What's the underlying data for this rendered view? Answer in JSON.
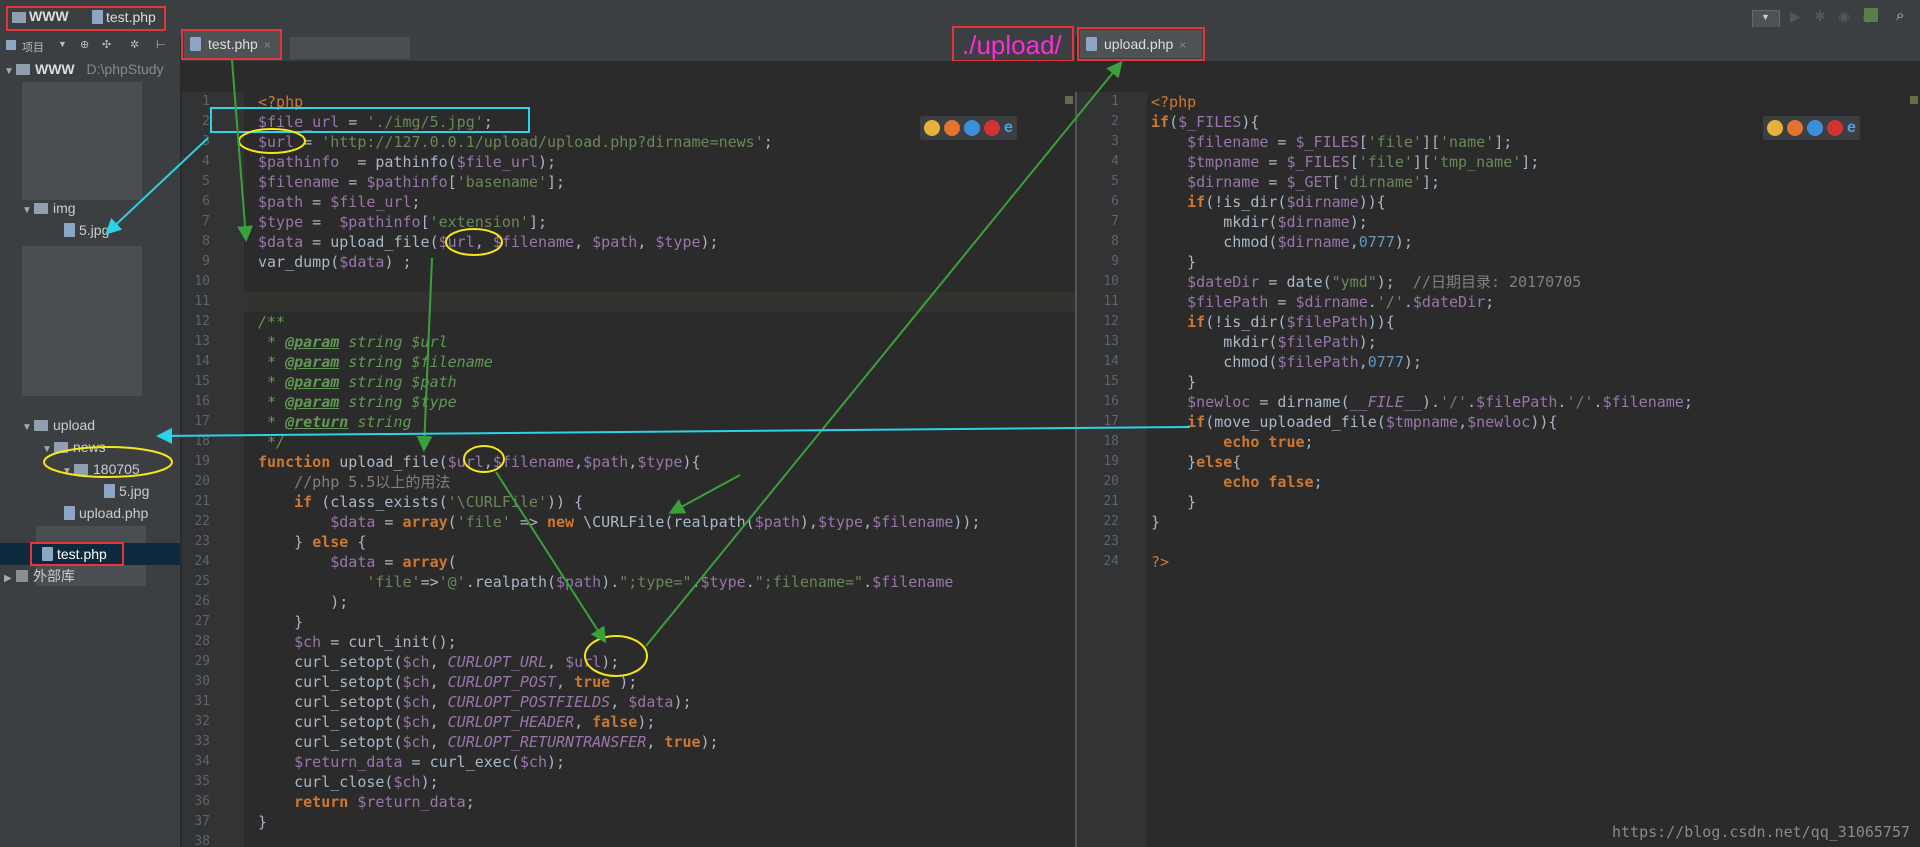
{
  "titlebar": {
    "project": "WWW",
    "file": "test.php"
  },
  "toolbar": {
    "project_label": "项目"
  },
  "sidebar": {
    "root_name": "WWW",
    "root_path": "D:\\phpStudy",
    "items": [
      {
        "label": "img"
      },
      {
        "label": "5.jpg"
      },
      {
        "label": "upload"
      },
      {
        "label": "news"
      },
      {
        "label": "180705"
      },
      {
        "label": "5.jpg"
      },
      {
        "label": "upload.php"
      },
      {
        "label": "test.php"
      },
      {
        "label": "外部库"
      }
    ]
  },
  "tabs": {
    "left": "test.php",
    "right": "upload.php"
  },
  "annotation": {
    "upload_path": "./upload/"
  },
  "left_editor": {
    "lines": [
      "<?php",
      "$file_url = './img/5.jpg';",
      "$url = 'http://127.0.0.1/upload/upload.php?dirname=news';",
      "$pathinfo  = pathinfo($file_url);",
      "$filename = $pathinfo['basename'];",
      "$path = $file_url;",
      "$type =  $pathinfo['extension'];",
      "$data = upload_file($url, $filename, $path, $type);",
      "var_dump($data) ;",
      "",
      "",
      "/**",
      " * @param string $url",
      " * @param string $filename",
      " * @param string $path",
      " * @param string $type",
      " * @return string",
      " */",
      "function upload_file($url,$filename,$path,$type){",
      "    //php 5.5以上的用法",
      "    if (class_exists('\\CURLFile')) {",
      "        $data = array('file' => new \\CURLFile(realpath($path),$type,$filename));",
      "    } else {",
      "        $data = array(",
      "            'file'=>'@'.realpath($path).\";type=\".$type.\";filename=\".$filename",
      "        );",
      "    }",
      "    $ch = curl_init();",
      "    curl_setopt($ch, CURLOPT_URL, $url);",
      "    curl_setopt($ch, CURLOPT_POST, true );",
      "    curl_setopt($ch, CURLOPT_POSTFIELDS, $data);",
      "    curl_setopt($ch, CURLOPT_HEADER, false);",
      "    curl_setopt($ch, CURLOPT_RETURNTRANSFER, true);",
      "    $return_data = curl_exec($ch);",
      "    curl_close($ch);",
      "    return $return_data;",
      "}",
      ""
    ]
  },
  "right_editor": {
    "lines": [
      "<?php",
      "if($_FILES){",
      "    $filename = $_FILES['file']['name'];",
      "    $tmpname = $_FILES['file']['tmp_name'];",
      "    $dirname = $_GET['dirname'];",
      "    if(!is_dir($dirname)){",
      "        mkdir($dirname);",
      "        chmod($dirname,0777);",
      "    }",
      "    $dateDir = date(\"ymd\");  //日期目录: 20170705",
      "    $filePath = $dirname.'/'.$dateDir;",
      "    if(!is_dir($filePath)){",
      "        mkdir($filePath);",
      "        chmod($filePath,0777);",
      "    }",
      "    $newloc = dirname(__FILE__).'/'.$filePath.'/'.$filename;",
      "    if(move_uploaded_file($tmpname,$newloc)){",
      "        echo true;",
      "    }else{",
      "        echo false;",
      "    }",
      "}",
      "",
      "?>"
    ]
  },
  "watermark": "https://blog.csdn.net/qq_31065757",
  "colors": {
    "annotation_red": "#e5343a",
    "annotation_cyan": "#29d3e8",
    "annotation_yellow": "#f5e616",
    "annotation_green": "#3aa13a",
    "annotation_magenta": "#ff2bd6"
  }
}
